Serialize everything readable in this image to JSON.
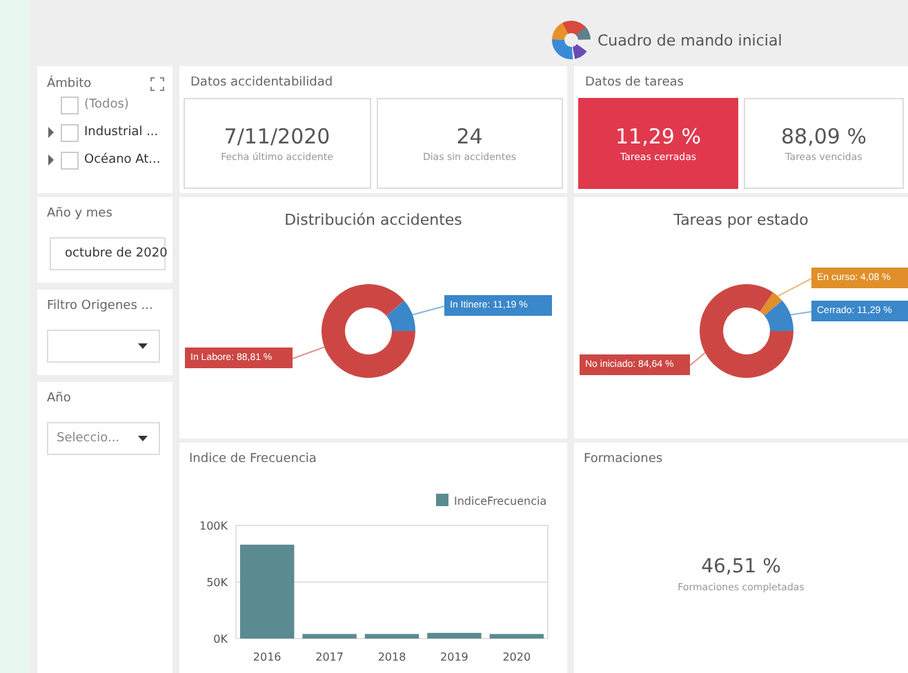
{
  "header": {
    "title": "Cuadro de mando inicial"
  },
  "scope_filter": {
    "title": "Ámbito",
    "items": [
      {
        "label": "(Todos)",
        "checked": false,
        "expandable": false
      },
      {
        "label": "Industrial ...",
        "checked": false,
        "expandable": true
      },
      {
        "label": "Océano At...",
        "checked": false,
        "expandable": true
      }
    ]
  },
  "filters": [
    {
      "kind": "input",
      "title": "Año y mes",
      "value": "octubre de 2020"
    },
    {
      "kind": "select",
      "title": "Filtro Origenes ..."
    },
    {
      "kind": "select",
      "title": "Año",
      "placeholder": "Seleccio..."
    }
  ],
  "accident_data": {
    "title": "Datos accidentabilidad",
    "cards": [
      {
        "value": "7/11/2020",
        "caption": "Fecha último accidente",
        "highlighted": false
      },
      {
        "value": "24",
        "caption": "Dias sin accidentes",
        "highlighted": false
      }
    ]
  },
  "task_data": {
    "title": "Datos de tareas",
    "cards": [
      {
        "value": "11,29 %",
        "caption": "Tareas cerradas",
        "highlighted": true
      },
      {
        "value": "88,09 %",
        "caption": "Tareas vencidas",
        "highlighted": false
      }
    ]
  },
  "accident_chart": {
    "chart_data": {
      "type": "donut",
      "title": "Distribución accidentes",
      "categories": [
        "In Labore",
        "In Itinere"
      ],
      "values": [
        88.81,
        11.19
      ],
      "value_labels": [
        "88,81 %",
        "11,19 %"
      ]
    }
  },
  "task_chart": {
    "chart_data": {
      "type": "donut",
      "title": "Tareas por estado",
      "categories": [
        "No iniciado",
        "En curso",
        "Cerrado"
      ],
      "values": [
        84.64,
        4.08,
        11.29
      ],
      "value_labels": [
        "84,64 %",
        "4,08 %",
        "11,29 %"
      ]
    }
  },
  "frequency_chart": {
    "title": "Indice de Frecuencia",
    "chart_data": {
      "type": "bar",
      "categories": [
        "2016",
        "2017",
        "2018",
        "2019",
        "2020"
      ],
      "series": [
        {
          "name": "IndiceFrecuencia",
          "color": "#5b8a90",
          "values": [
            83000,
            4000,
            4000,
            5000,
            4000
          ]
        }
      ],
      "ylim": [
        0,
        100000
      ],
      "yticks": [
        {
          "value": 0,
          "label": "0K"
        },
        {
          "value": 50000,
          "label": "50K"
        },
        {
          "value": 100000,
          "label": "100K"
        }
      ]
    }
  },
  "training": {
    "title": "Formaciones",
    "value": "46,51 %",
    "caption": "Formaciones completadas"
  }
}
